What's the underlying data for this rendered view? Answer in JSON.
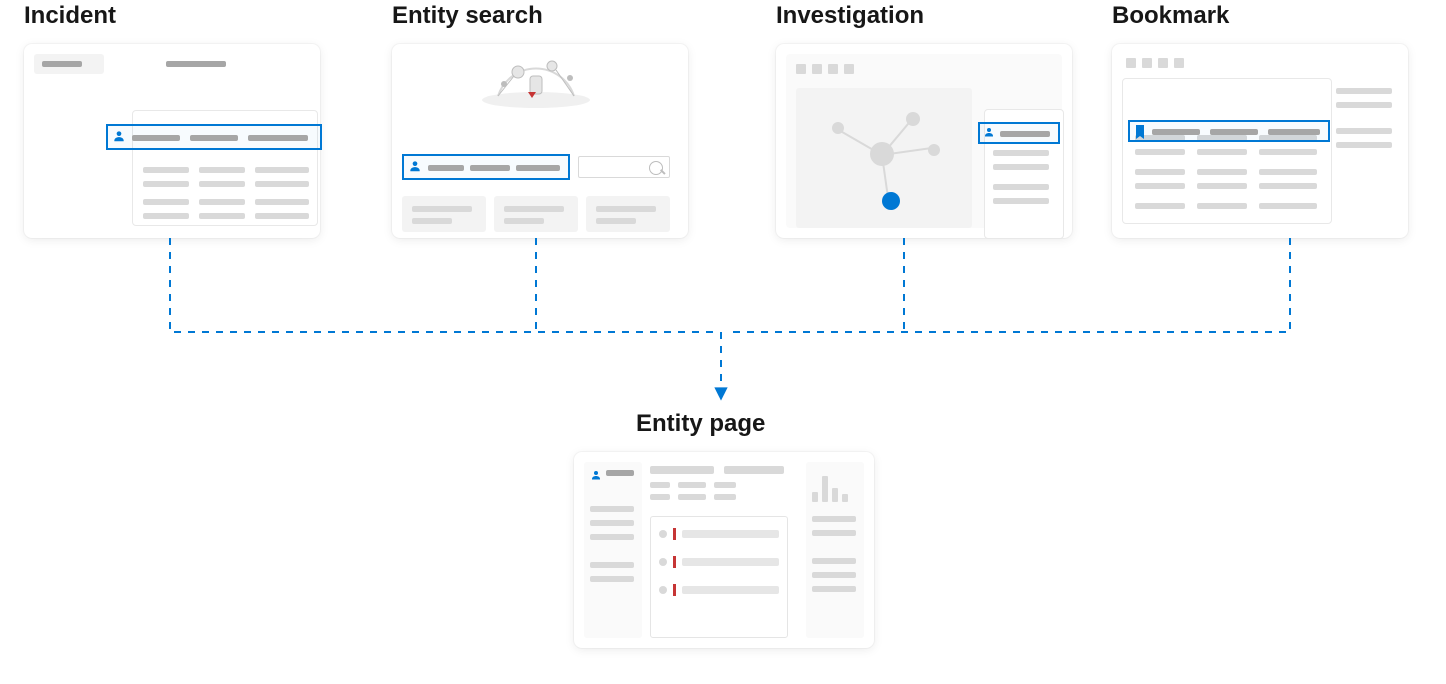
{
  "diagram": {
    "type": "flow",
    "description": "Four source views (Incident, Entity search, Investigation, Bookmark) all leading to the Entity page.",
    "sources": [
      {
        "id": "incident",
        "label": "Incident"
      },
      {
        "id": "entity_search",
        "label": "Entity search"
      },
      {
        "id": "investigation",
        "label": "Investigation"
      },
      {
        "id": "bookmark",
        "label": "Bookmark"
      }
    ],
    "target": {
      "id": "entity_page",
      "label": "Entity page"
    },
    "colors": {
      "accent": "#0078d4",
      "node_highlight": "#0078d4",
      "text": "#171717",
      "muted": "#d9d9d9",
      "alert": "#c63535"
    }
  }
}
